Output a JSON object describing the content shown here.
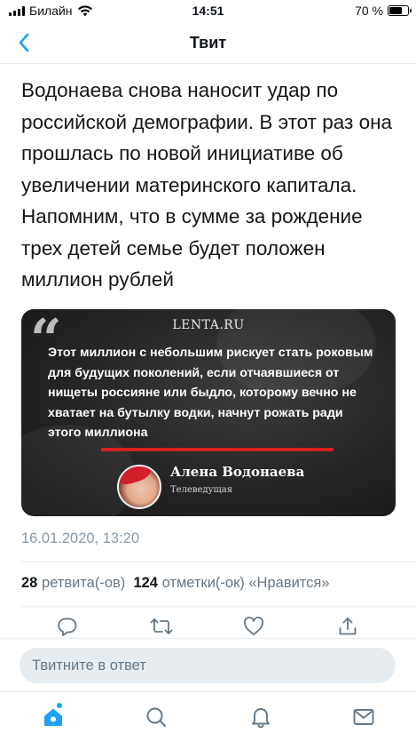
{
  "status_bar": {
    "carrier": "Билайн",
    "time": "14:51",
    "battery": "70 %",
    "battery_level": 0.7
  },
  "header": {
    "title": "Твит",
    "back_icon": "chevron-left-icon"
  },
  "tweet": {
    "text": "Водонаева снова наносит удар по российской демографии. В этот раз она прошлась по новой инициативе об увеличении материнского капитала. Напомним, что в сумме за рождение трех детей семье будет положен миллион рублей",
    "card": {
      "brand": "LENTA.RU",
      "quote": "Этот миллион с небольшим рискует стать роковым для будущих поколений, если отчаявшиеся от нищеты россияне или быдло, которому вечно не хватает на бутылку водки, начнут рожать ради этого миллиона",
      "author_name": "Алена Водонаева",
      "author_role": "Телеведущая",
      "accent_color": "#d62020"
    },
    "timestamp": "16.01.2020, 13:20",
    "stats": {
      "retweets_count": "28",
      "retweets_label": "ретвита(-ов)",
      "likes_count": "124",
      "likes_label": "отметки(-ок) «Нравится»"
    }
  },
  "actions": [
    "reply-icon",
    "retweet-icon",
    "like-icon",
    "share-icon"
  ],
  "reply": {
    "placeholder": "Твитните в ответ"
  },
  "tab_bar": {
    "items": [
      "home-icon",
      "search-icon",
      "notifications-icon",
      "messages-icon"
    ],
    "active": "home-icon",
    "accent_color": "#1da1f2"
  }
}
